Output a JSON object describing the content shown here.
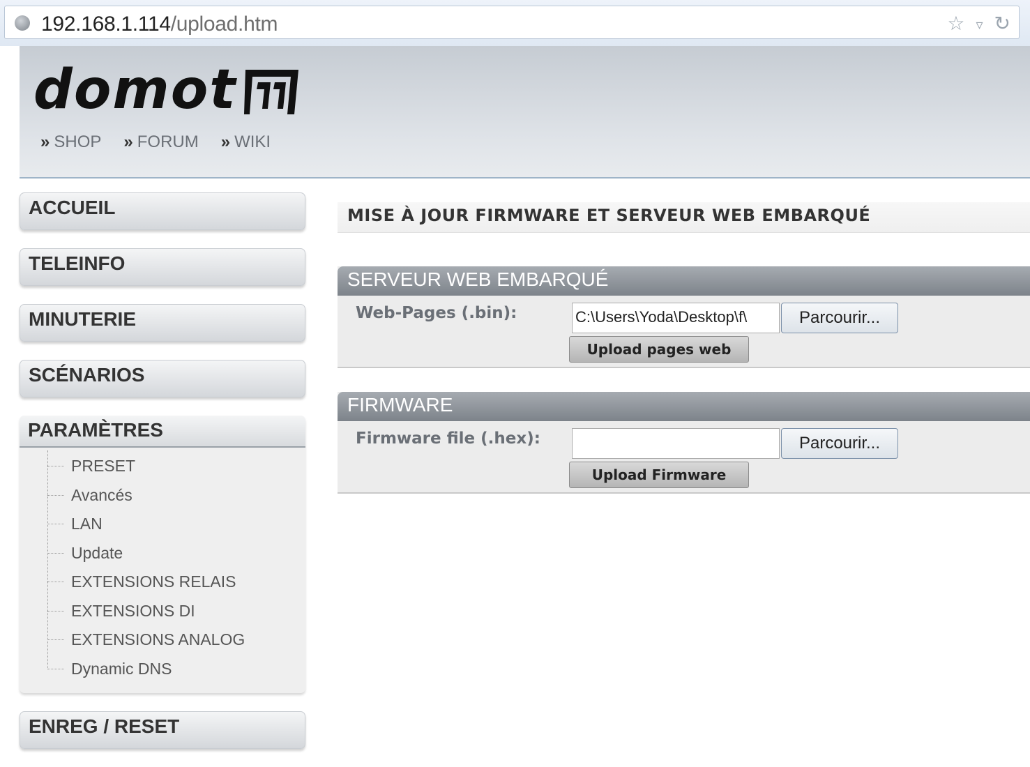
{
  "browser": {
    "url_host": "192.168.1.114",
    "url_path": "/upload.htm",
    "icons": [
      "star-icon",
      "dropdown-icon",
      "reload-icon"
    ]
  },
  "header": {
    "logo_text": "domot",
    "links": [
      {
        "label": "SHOP"
      },
      {
        "label": "FORUM"
      },
      {
        "label": "WIKI"
      }
    ]
  },
  "sidebar": {
    "items": [
      {
        "label": "ACCUEIL"
      },
      {
        "label": "TELEINFO"
      },
      {
        "label": "MINUTERIE"
      },
      {
        "label": "SCÉNARIOS"
      }
    ],
    "params": {
      "label": "PARAMÈTRES",
      "subitems": [
        {
          "label": "PRESET"
        },
        {
          "label": "Avancés"
        },
        {
          "label": "LAN"
        },
        {
          "label": "Update"
        },
        {
          "label": "EXTENSIONS RELAIS"
        },
        {
          "label": "EXTENSIONS DI"
        },
        {
          "label": "EXTENSIONS ANALOG"
        },
        {
          "label": "Dynamic DNS"
        }
      ]
    },
    "bottom_item": {
      "label": "ENREG / RESET"
    }
  },
  "main": {
    "title": "MISE À JOUR FIRMWARE ET SERVEUR WEB EMBARQUÉ",
    "webserver": {
      "heading": "SERVEUR WEB EMBARQUÉ",
      "field_label": "Web-Pages (.bin):",
      "file_value": "C:\\Users\\Yoda\\Desktop\\f\\",
      "browse_label": "Parcourir...",
      "upload_label": "Upload pages web"
    },
    "firmware": {
      "heading": "FIRMWARE",
      "field_label": "Firmware file (.hex):",
      "file_value": "",
      "browse_label": "Parcourir...",
      "upload_label": "Upload Firmware"
    }
  },
  "colors": {
    "panel_header": "#7d838a",
    "header_bg": "#d3d8de",
    "sidebar_button": "#d4d7db"
  }
}
